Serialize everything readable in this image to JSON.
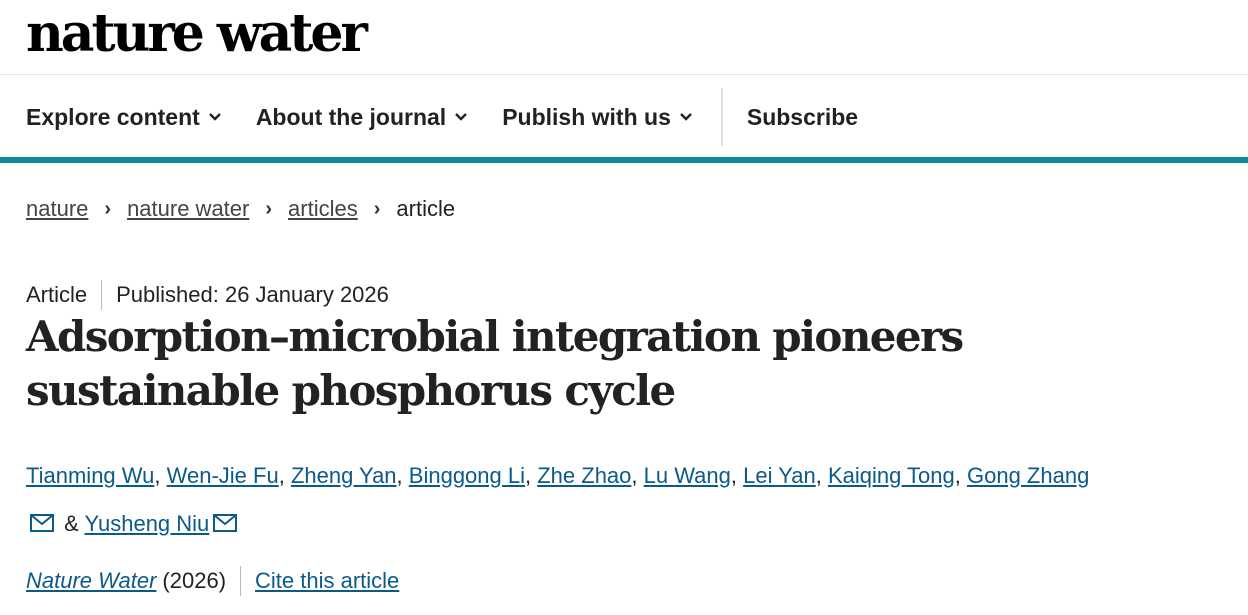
{
  "header": {
    "logo": "nature water"
  },
  "nav": {
    "items": [
      {
        "label": "Explore content",
        "has_dropdown": true
      },
      {
        "label": "About the journal",
        "has_dropdown": true
      },
      {
        "label": "Publish with us",
        "has_dropdown": true
      }
    ],
    "subscribe": "Subscribe"
  },
  "breadcrumbs": [
    "nature",
    "nature water",
    "articles",
    "article"
  ],
  "article": {
    "type": "Article",
    "published": "Published: 26 January 2026",
    "title": "Adsorption–microbial integration pioneers sustainable phosphorus cycle",
    "authors": [
      "Tianming Wu",
      "Wen-Jie Fu",
      "Zheng Yan",
      "Binggong Li",
      "Zhe Zhao",
      "Lu Wang",
      "Lei Yan",
      "Kaiqing Tong",
      "Gong Zhang"
    ],
    "last_author": "Yusheng Niu",
    "ampersand": "&",
    "journal": "Nature Water",
    "year": "(2026)",
    "cite": "Cite this article"
  },
  "colors": {
    "accent_teal": "#0e8a92",
    "link": "#0b5a8a"
  }
}
